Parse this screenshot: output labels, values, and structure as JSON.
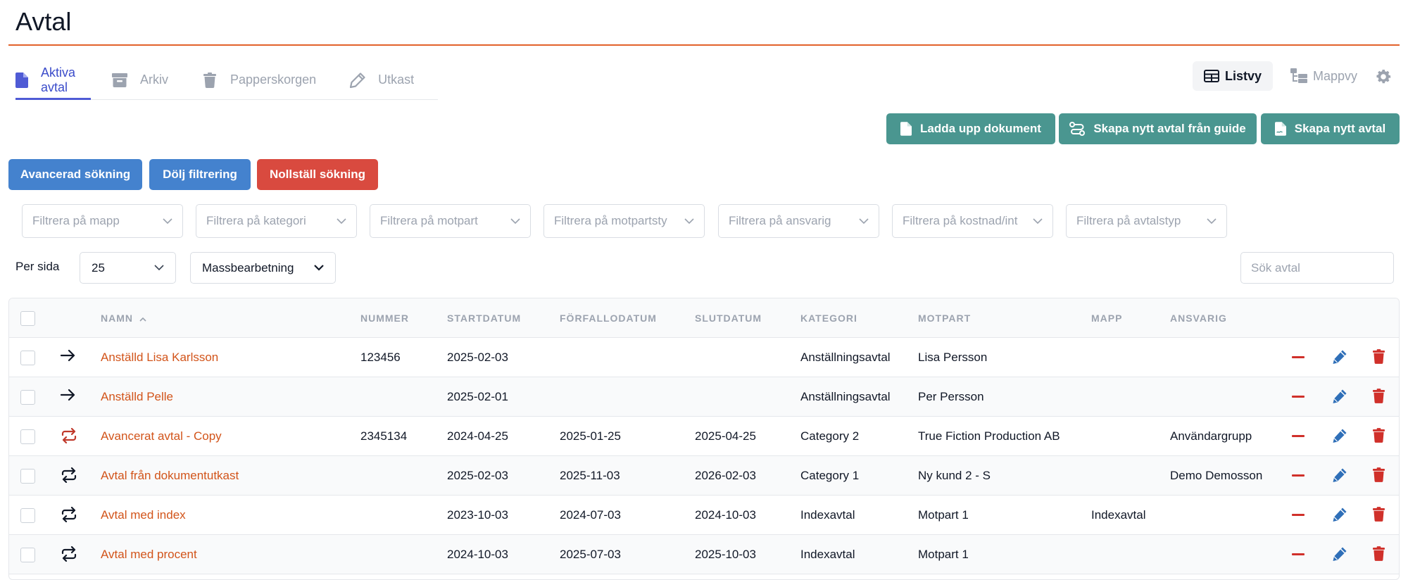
{
  "page": {
    "title": "Avtal"
  },
  "tabs": [
    {
      "label": "Aktiva avtal",
      "icon": "file-icon",
      "active": true
    },
    {
      "label": "Arkiv",
      "icon": "archive-icon",
      "active": false
    },
    {
      "label": "Papperskorgen",
      "icon": "trash-icon",
      "active": false
    },
    {
      "label": "Utkast",
      "icon": "pencil-icon",
      "active": false
    }
  ],
  "views": {
    "list_label": "Listvy",
    "folder_label": "Mappvy"
  },
  "actions": {
    "upload": "Ladda upp dokument",
    "guide": "Skapa nytt avtal från guide",
    "create": "Skapa nytt avtal"
  },
  "search_buttons": {
    "advanced": "Avancerad sökning",
    "hide_filter": "Dölj filtrering",
    "reset": "Nollställ sökning"
  },
  "filters": [
    "Filtrera på mapp",
    "Filtrera på kategori",
    "Filtrera på motpart",
    "Filtrera på motpartsty",
    "Filtrera på ansvarig",
    "Filtrera på kostnad/int",
    "Filtrera på avtalstyp"
  ],
  "controls": {
    "per_page_label": "Per sida",
    "per_page_value": "25",
    "bulk_label": "Massbearbetning",
    "search_placeholder": "Sök avtal"
  },
  "colors": {
    "accent": "#e2622b",
    "teal": "#4a9690",
    "blue": "#4482ce",
    "red": "#d94a3f",
    "link": "#d2541a"
  },
  "table": {
    "columns": {
      "name": "NAMN",
      "number": "NUMMER",
      "start": "STARTDATUM",
      "due": "FÖRFALLODATUM",
      "end": "SLUTDATUM",
      "category": "KATEGORI",
      "party": "MOTPART",
      "folder": "MAPP",
      "responsible": "ANSVARIG"
    },
    "rows": [
      {
        "type_icon": "arrow-right-icon",
        "name": "Anställd Lisa Karlsson",
        "number": "123456",
        "start": "2025-02-03",
        "due": "",
        "end": "",
        "category": "Anställningsavtal",
        "party": "Lisa Persson",
        "folder": "",
        "responsible": ""
      },
      {
        "type_icon": "arrow-right-icon",
        "name": "Anställd Pelle",
        "number": "",
        "start": "2025-02-01",
        "due": "",
        "end": "",
        "category": "Anställningsavtal",
        "party": "Per Persson",
        "folder": "",
        "responsible": ""
      },
      {
        "type_icon": "repeat-icon",
        "name": "Avancerat avtal - Copy",
        "number": "2345134",
        "start": "2024-04-25",
        "due": "2025-01-25",
        "end": "2025-04-25",
        "category": "Category 2",
        "party": "True Fiction Production AB",
        "folder": "",
        "responsible": "Användargrupp"
      },
      {
        "type_icon": "repeat-icon",
        "name": "Avtal från dokumentutkast",
        "number": "",
        "start": "2025-02-03",
        "due": "2025-11-03",
        "end": "2026-02-03",
        "category": "Category 1",
        "party": "Ny kund 2 - S",
        "folder": "",
        "responsible": "Demo Demosson"
      },
      {
        "type_icon": "repeat-icon",
        "name": "Avtal med index",
        "number": "",
        "start": "2023-10-03",
        "due": "2024-07-03",
        "end": "2024-10-03",
        "category": "Indexavtal",
        "party": "Motpart 1",
        "folder": "Indexavtal",
        "responsible": ""
      },
      {
        "type_icon": "repeat-icon",
        "name": "Avtal med procent",
        "number": "",
        "start": "2024-10-03",
        "due": "2025-07-03",
        "end": "2025-10-03",
        "category": "Indexavtal",
        "party": "Motpart 1",
        "folder": "",
        "responsible": ""
      }
    ]
  }
}
